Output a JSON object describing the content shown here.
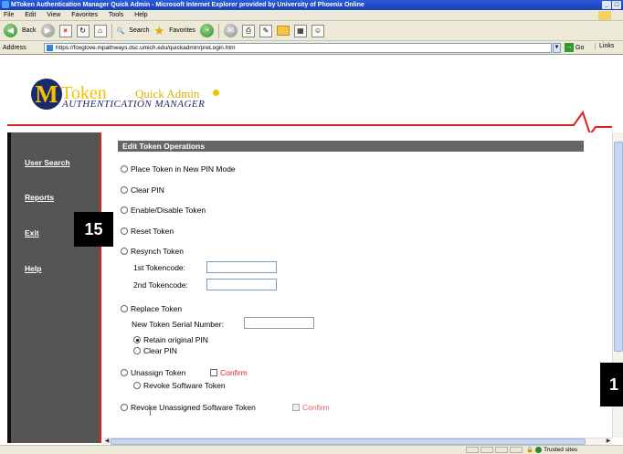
{
  "window": {
    "title": "MToken Authentication Manager Quick Admin - Microsoft Internet Explorer provided by University of Phoenix Online"
  },
  "menu": [
    "File",
    "Edit",
    "View",
    "Favorites",
    "Tools",
    "Help"
  ],
  "toolbar": {
    "back": "Back",
    "search": "Search",
    "favorites": "Favorites"
  },
  "address": {
    "label": "Address",
    "url": "https://foxglove.mpathways.dsc.umich.edu/quickadmin/preLogin.htm",
    "go": "Go",
    "links": "Links"
  },
  "logo": {
    "letter": "M",
    "token": "Token",
    "quick_admin": "Quick Admin",
    "subtitle": "AUTHENTICATION MANAGER"
  },
  "sidebar": {
    "items": [
      {
        "label": "User Search"
      },
      {
        "label": "Reports"
      },
      {
        "label": "Exit"
      },
      {
        "label": "Help"
      }
    ]
  },
  "content": {
    "section_title": "Edit Token Operations",
    "options": {
      "place_pin": "Place Token in New PIN Mode",
      "clear_pin": "Clear PIN",
      "enable_disable": "Enable/Disable Token",
      "reset": "Reset Token",
      "resynch": "Resynch Token",
      "replace": "Replace Token",
      "unassign": "Unassign Token",
      "revoke_unassigned": "Revoke Unassigned Software Token"
    },
    "resynch_fields": {
      "first": "1st Tokencode:",
      "second": "2nd Tokencode:"
    },
    "replace_fields": {
      "serial": "New Token Serial Number:",
      "retain_pin": "Retain original PIN",
      "clear_pin": "Clear PIN"
    },
    "unassign_fields": {
      "confirm": "Confirm",
      "revoke_software": "Revoke Software Token"
    },
    "revoke_confirm": "Confirm"
  },
  "status": {
    "zone": "Trusted sites"
  },
  "callouts": {
    "step": "15",
    "right": "1"
  }
}
